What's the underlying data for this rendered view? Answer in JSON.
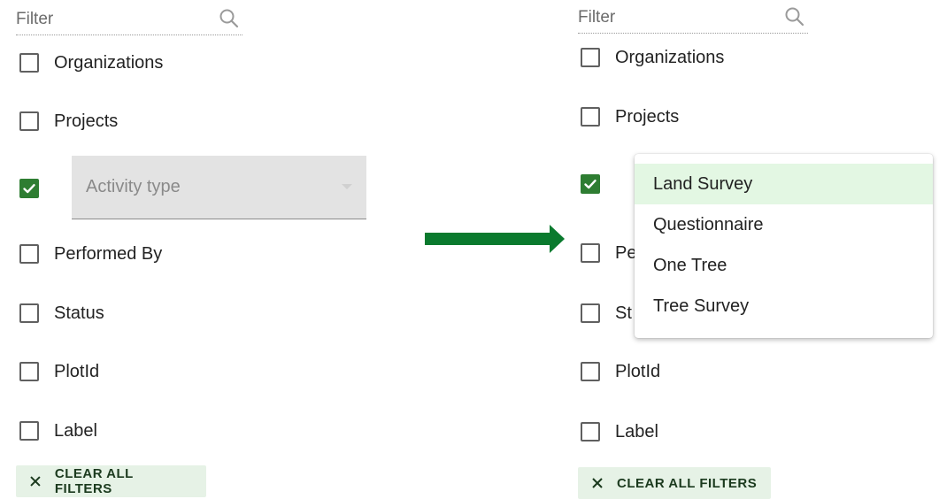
{
  "left": {
    "filter_placeholder": "Filter",
    "rows": [
      {
        "label": "Organizations",
        "checked": false
      },
      {
        "label": "Projects",
        "checked": false
      },
      {
        "label": "",
        "checked": true
      },
      {
        "label": "Performed By",
        "checked": false
      },
      {
        "label": "Status",
        "checked": false
      },
      {
        "label": "PlotId",
        "checked": false
      },
      {
        "label": "Label",
        "checked": false
      }
    ],
    "select_label": "Activity type",
    "clear_label": "CLEAR ALL FILTERS"
  },
  "right": {
    "filter_placeholder": "Filter",
    "rows": [
      {
        "label": "Organizations",
        "checked": false
      },
      {
        "label": "Projects",
        "checked": false
      },
      {
        "label": "",
        "checked": true
      },
      {
        "label": "Pe",
        "checked": false
      },
      {
        "label": "St",
        "checked": false
      },
      {
        "label": "PlotId",
        "checked": false
      },
      {
        "label": "Label",
        "checked": false
      }
    ],
    "clear_label": "CLEAR ALL FILTERS",
    "dropdown_options": [
      "Land Survey",
      "Questionnaire",
      "One Tree",
      "Tree Survey"
    ],
    "dropdown_active": "Land Survey"
  },
  "colors": {
    "accent": "#2e7d32",
    "arrow": "#0a7a2e",
    "clear_bg": "#e6f2e6",
    "active_option_bg": "#e3f7e3"
  },
  "icons": {
    "search": "search-icon",
    "check": "check-icon",
    "clear": "close-icon",
    "caret": "caret-down-icon",
    "arrow": "arrow-right-icon"
  }
}
